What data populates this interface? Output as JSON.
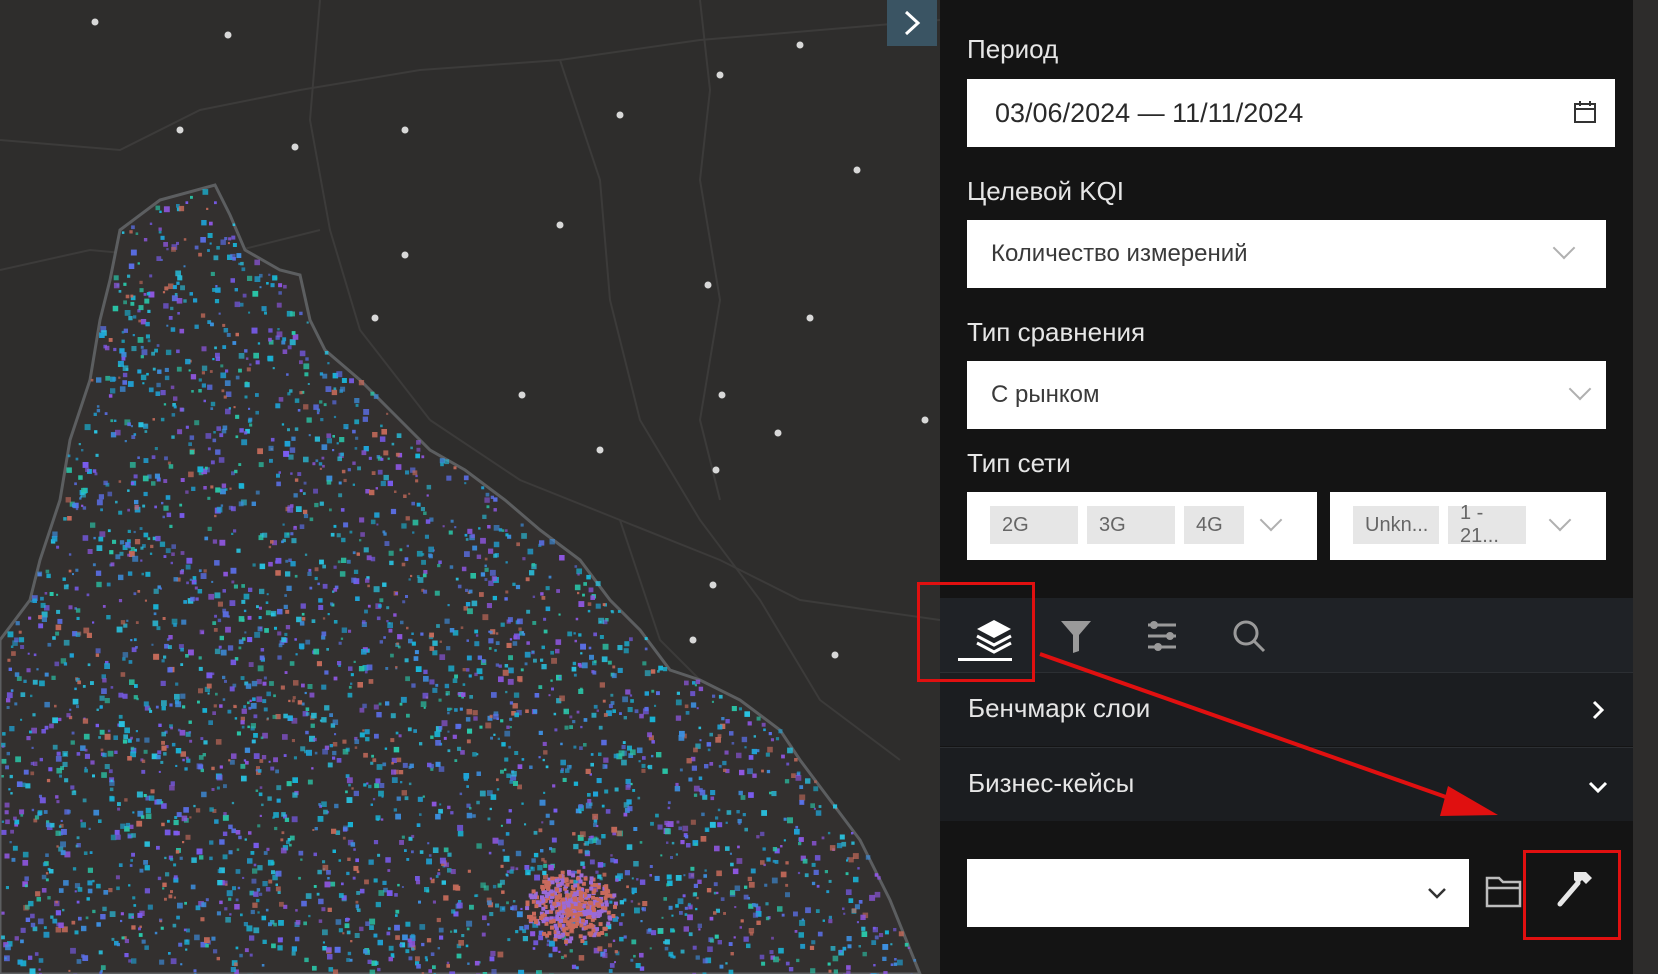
{
  "panel": {
    "period": {
      "label": "Период",
      "value": "03/06/2024 — 11/11/2024"
    },
    "kqi": {
      "label": "Целевой KQI",
      "value": "Количество измерений"
    },
    "comparison": {
      "label": "Тип сравнения",
      "value": "С рынком"
    },
    "network": {
      "label": "Тип сети",
      "types": [
        "2G",
        "3G",
        "4G"
      ],
      "extra": [
        "Unkn...",
        "1 - 21..."
      ]
    },
    "toolbar": {
      "icons": [
        "layers-icon",
        "filter-icon",
        "sliders-icon",
        "search-icon"
      ],
      "active": "layers-icon"
    },
    "sections": [
      {
        "label": "Бенчмарк слои",
        "state": "collapsed"
      },
      {
        "label": "Бизнес-кейсы",
        "state": "expanded"
      }
    ],
    "business_case_select": {
      "value": ""
    }
  },
  "colors": {
    "accent_annotation": "#e01010",
    "map_background": "#2e2d2c",
    "panel_background": "#141414"
  }
}
